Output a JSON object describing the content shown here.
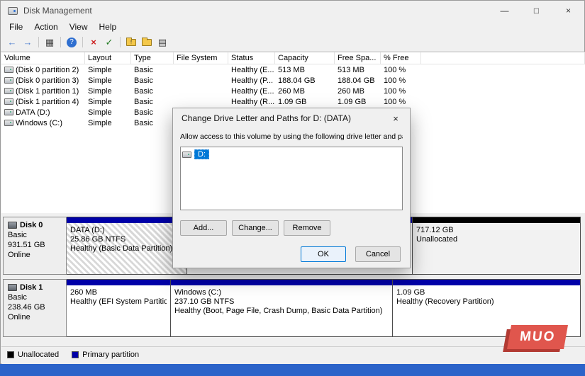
{
  "colors": {
    "accent": "#0078d7",
    "primary-stripe": "#0000a8",
    "unalloc-stripe": "#000000",
    "taskbar-blue": "#2b63c9",
    "muo-red": "#e0564d"
  },
  "window": {
    "title": "Disk Management",
    "minimize": "—",
    "maximize": "□",
    "close": "×"
  },
  "menubar": {
    "items": [
      {
        "label": "File"
      },
      {
        "label": "Action"
      },
      {
        "label": "View"
      },
      {
        "label": "Help"
      }
    ]
  },
  "toolbar": {
    "icons": [
      {
        "name": "back",
        "glyph": "←"
      },
      {
        "name": "forward",
        "glyph": "→"
      },
      {
        "name": "console-tree",
        "glyph": "▦"
      },
      {
        "name": "help",
        "glyph": "?"
      },
      {
        "name": "delete-volume",
        "glyph": "×"
      },
      {
        "name": "mark-active",
        "glyph": "✓"
      },
      {
        "name": "folder-up",
        "glyph": "↑"
      },
      {
        "name": "properties-list",
        "glyph": "▤"
      }
    ]
  },
  "volume_table": {
    "columns": [
      "Volume",
      "Layout",
      "Type",
      "File System",
      "Status",
      "Capacity",
      "Free Spa...",
      "% Free"
    ],
    "rows": [
      {
        "volume": "(Disk 0 partition 2)",
        "layout": "Simple",
        "type": "Basic",
        "fs": "",
        "status": "Healthy (E...",
        "capacity": "513 MB",
        "free": "513 MB",
        "pct": "100 %"
      },
      {
        "volume": "(Disk 0 partition 3)",
        "layout": "Simple",
        "type": "Basic",
        "fs": "",
        "status": "Healthy (P...",
        "capacity": "188.04 GB",
        "free": "188.04 GB",
        "pct": "100 %"
      },
      {
        "volume": "(Disk 1 partition 1)",
        "layout": "Simple",
        "type": "Basic",
        "fs": "",
        "status": "Healthy (E...",
        "capacity": "260 MB",
        "free": "260 MB",
        "pct": "100 %"
      },
      {
        "volume": "(Disk 1 partition 4)",
        "layout": "Simple",
        "type": "Basic",
        "fs": "",
        "status": "Healthy (R...",
        "capacity": "1.09 GB",
        "free": "1.09 GB",
        "pct": "100 %"
      },
      {
        "volume": "DATA (D:)",
        "layout": "Simple",
        "type": "Basic",
        "fs": "",
        "status": "",
        "capacity": "",
        "free": "",
        "pct": ""
      },
      {
        "volume": "Windows (C:)",
        "layout": "Simple",
        "type": "Basic",
        "fs": "",
        "status": "",
        "capacity": "",
        "free": "",
        "pct": ""
      }
    ]
  },
  "dialog": {
    "title": "Change Drive Letter and Paths for D: (DATA)",
    "close": "×",
    "instruction": "Allow access to this volume by using the following drive letter and paths:",
    "list": [
      {
        "label": "D:",
        "selected": true
      }
    ],
    "buttons": {
      "add": "Add...",
      "change": "Change...",
      "remove": "Remove",
      "ok": "OK",
      "cancel": "Cancel"
    }
  },
  "disks": [
    {
      "name": "Disk 0",
      "type": "Basic",
      "size": "931.51 GB",
      "status": "Online",
      "partitions": [
        {
          "line1": "DATA (D:)",
          "line2": "25.86 GB NTFS",
          "line3": "Healthy (Basic Data Partition)"
        },
        {
          "line1": "",
          "line2": "",
          "line3": ""
        },
        {
          "line1": "717.12 GB",
          "line2": "Unallocated",
          "line3": ""
        }
      ]
    },
    {
      "name": "Disk 1",
      "type": "Basic",
      "size": "238.46 GB",
      "status": "Online",
      "partitions": [
        {
          "line1": "260 MB",
          "line2": "Healthy (EFI System Partitio",
          "line3": ""
        },
        {
          "line1": "Windows (C:)",
          "line2": "237.10 GB NTFS",
          "line3": "Healthy (Boot, Page File, Crash Dump, Basic Data Partition)"
        },
        {
          "line1": "1.09 GB",
          "line2": "Healthy (Recovery Partition)",
          "line3": ""
        }
      ]
    }
  ],
  "legend": {
    "unallocated": "Unallocated",
    "primary": "Primary partition"
  },
  "watermark": {
    "text": "MUO"
  }
}
